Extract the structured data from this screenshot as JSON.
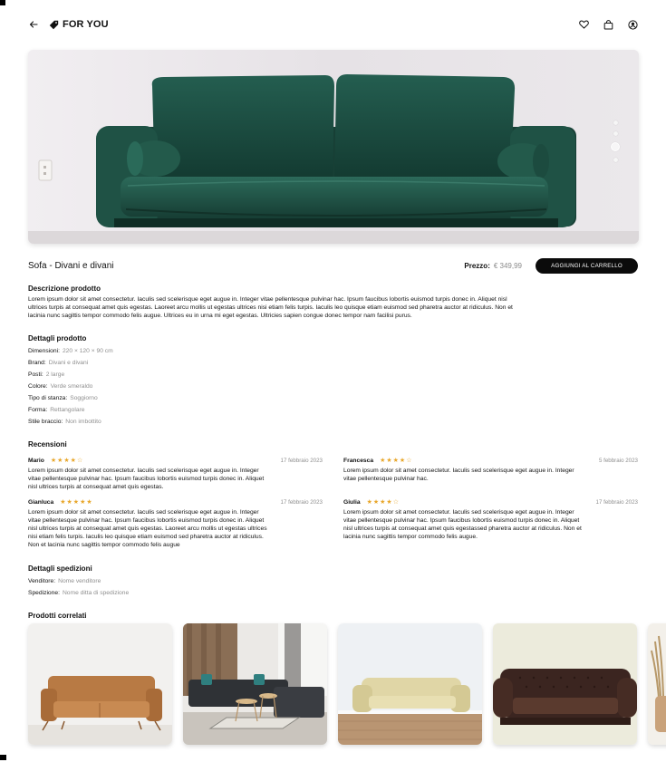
{
  "header": {
    "brand": "FOR YOU",
    "icons": [
      "arrow-left-icon",
      "tag-icon",
      "heart-icon",
      "shopping-bag-icon",
      "user-circle-icon"
    ]
  },
  "hero": {
    "image": "green velvet sofa",
    "slide_count": 4,
    "active_slide": 3
  },
  "product": {
    "title": "Sofa - Divani e divani",
    "price_label": "Prezzo:",
    "price_value": "€ 349,99",
    "cart_button": "AGGIUNGI AL CARRELLO"
  },
  "description": {
    "title": "Descrizione prodotto",
    "lines": [
      "Lorem ipsum dolor sit amet consectetur. Iaculis sed scelerisque eget augue in. Integer vitae pellentesque pulvinar hac. Ipsum faucibus lobortis euismod turpis donec in. Aliquet nisl",
      "ultrices turpis at consequat amet quis egestas. Laoreet arcu mollis ut egestas ultrices nisi etiam felis turpis. Iaculis leo quisque etiam euismod sed pharetra auctor at ridiculus. Non et",
      "lacinia nunc sagittis tempor commodo felis augue. Ultrices eu in urna mi eget egestas. Ultricies sapien congue donec tempor nam facilisi purus."
    ]
  },
  "details": {
    "title": "Dettagli prodotto",
    "rows": [
      {
        "key": "Dimensioni:",
        "value": "220 × 120 × 90 cm"
      },
      {
        "key": "Brand:",
        "value": "Divani e divani"
      },
      {
        "key": "Posti:",
        "value": "2 large"
      },
      {
        "key": "Colore:",
        "value": "Verde smeraldo"
      },
      {
        "key": "Tipo di stanza:",
        "value": "Soggiorno"
      },
      {
        "key": "Forma:",
        "value": "Rettangolare"
      },
      {
        "key": "Stile braccio:",
        "value": "Non imbottito"
      }
    ]
  },
  "reviews": {
    "title": "Recensioni",
    "items": [
      {
        "name": "Mario",
        "stars": "★★★★☆",
        "rating": 4.5,
        "date": "17 febbraio 2023",
        "lines": [
          "Lorem ipsum dolor sit amet consectetur. Iaculis sed scelerisque eget augue in. Integer",
          "vitae pellentesque pulvinar hac. Ipsum faucibus lobortis euismod turpis donec in. Aliquet",
          "nisl ultrices turpis at consequat amet quis egestas."
        ]
      },
      {
        "name": "Francesca",
        "stars": "★★★★☆",
        "rating": 4.5,
        "date": "5 febbraio 2023",
        "lines": [
          "Lorem ipsum dolor sit amet consectetur. Iaculis sed scelerisque eget augue in. Integer",
          "vitae pellentesque pulvinar hac."
        ]
      },
      {
        "name": "Gianluca",
        "stars": "★★★★★",
        "rating": 5,
        "date": "17 febbraio 2023",
        "lines": [
          "Lorem ipsum dolor sit amet consectetur. Iaculis sed scelerisque eget augue in. Integer",
          "vitae pellentesque pulvinar hac. Ipsum faucibus lobortis euismod turpis donec in. Aliquet",
          "nisl ultrices turpis at consequat amet quis egestas. Laoreet arcu mollis ut egestas ultrices",
          "nisi etiam felis turpis. Iaculis leo quisque etiam euismod sed pharetra auctor at ridiculus.",
          "Non et lacinia nunc sagittis tempor commodo felis augue"
        ]
      },
      {
        "name": "Giulia",
        "stars": "★★★★☆",
        "rating": 4.5,
        "date": "17 febbraio 2023",
        "lines": [
          "Lorem ipsum dolor sit amet consectetur. Iaculis sed scelerisque eget augue in. Integer",
          "vitae pellentesque pulvinar hac. Ipsum faucibus lobortis euismod turpis donec in. Aliquet",
          "nisl ultrices turpis at consequat amet quis egestassed pharetra auctor at ridiculus. Non et",
          "lacinia nunc sagittis tempor commodo felis augue."
        ]
      }
    ]
  },
  "shipping": {
    "title": "Dettagli spedizioni",
    "rows": [
      {
        "key": "Venditore:",
        "value": "Nome venditore"
      },
      {
        "key": "Spedizione:",
        "value": "Nome ditta di spedizione"
      }
    ]
  },
  "related": {
    "title": "Prodotti correlati",
    "items": [
      "tan leather sofa",
      "grey sectional sofa in living room",
      "cream sofa",
      "brown chesterfield sofa",
      "partial sofa with dried grass"
    ]
  },
  "colors": {
    "accent_star": "#e8a72b",
    "button_bg": "#0b0b0b",
    "muted_text": "#8f8f8f",
    "sofa_green": "#1f5245"
  }
}
